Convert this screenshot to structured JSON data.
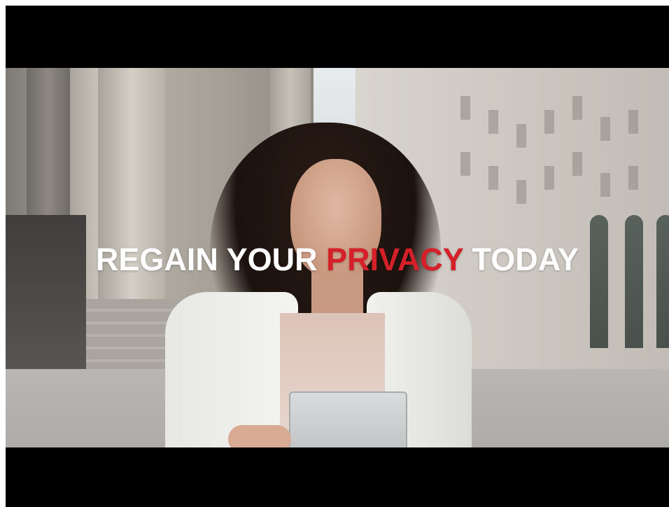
{
  "video": {
    "headline_part1": "REGAIN YOUR ",
    "headline_accent": "PRIVACY",
    "headline_part2": " TODAY",
    "accent_color": "#d5202a",
    "text_color": "#ffffff",
    "letterbox_color": "#000000"
  }
}
